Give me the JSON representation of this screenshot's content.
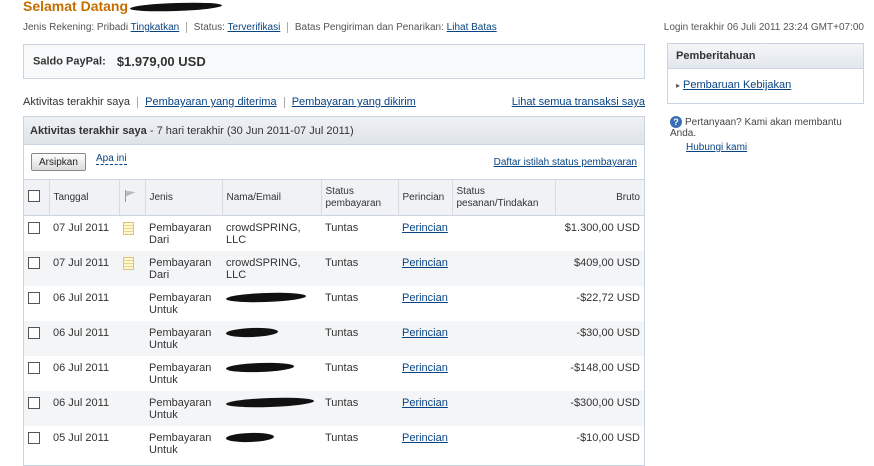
{
  "header": {
    "welcome": "Selamat Datang",
    "account_type_label": "Jenis Rekening: Pribadi",
    "upgrade_link": "Tingkatkan",
    "status_label": "Status:",
    "status_link": "Terverifikasi",
    "limits_label": "Batas Pengiriman dan Penarikan:",
    "limits_link": "Lihat Batas",
    "last_login": "Login terakhir 06 Juli 2011 23:24 GMT+07:00"
  },
  "balance": {
    "label": "Saldo PayPal:",
    "amount": "$1.979,00 USD"
  },
  "activity_links": {
    "recent": "Aktivitas terakhir saya",
    "received": "Pembayaran yang diterima",
    "sent": "Pembayaran yang dikirim",
    "see_all": "Lihat semua transaksi saya"
  },
  "activity": {
    "title": "Aktivitas terakhir saya",
    "subtitle": " - 7 hari terakhir (30 Jun 2011-07 Jul 2011)",
    "archive_button": "Arsipkan",
    "what_link": "Apa ini",
    "glossary_link": "Daftar istilah status pembayaran",
    "columns": {
      "date": "Tanggal",
      "type": "Jenis",
      "name": "Nama/Email",
      "payment_status": "Status pembayaran",
      "details": "Perincian",
      "order_status": "Status pesanan/Tindakan",
      "gross": "Bruto"
    },
    "rows": [
      {
        "date": "07 Jul 2011",
        "note": true,
        "type": "Pembayaran Dari",
        "name": "crowdSPRING, LLC",
        "name_redacted": false,
        "status": "Tuntas",
        "details": "Perincian",
        "order": "",
        "gross": "$1.300,00 USD"
      },
      {
        "date": "07 Jul 2011",
        "note": true,
        "type": "Pembayaran Dari",
        "name": "crowdSPRING, LLC",
        "name_redacted": false,
        "status": "Tuntas",
        "details": "Perincian",
        "order": "",
        "gross": "$409,00 USD"
      },
      {
        "date": "06 Jul 2011",
        "note": false,
        "type": "Pembayaran Untuk",
        "name": "",
        "name_redacted": true,
        "status": "Tuntas",
        "details": "Perincian",
        "order": "",
        "gross": "-$22,72 USD"
      },
      {
        "date": "06 Jul 2011",
        "note": false,
        "type": "Pembayaran Untuk",
        "name": "",
        "name_redacted": true,
        "status": "Tuntas",
        "details": "Perincian",
        "order": "",
        "gross": "-$30,00 USD"
      },
      {
        "date": "06 Jul 2011",
        "note": false,
        "type": "Pembayaran Untuk",
        "name": "",
        "name_redacted": true,
        "status": "Tuntas",
        "details": "Perincian",
        "order": "",
        "gross": "-$148,00 USD"
      },
      {
        "date": "06 Jul 2011",
        "note": false,
        "type": "Pembayaran Untuk",
        "name": "",
        "name_redacted": true,
        "status": "Tuntas",
        "details": "Perincian",
        "order": "",
        "gross": "-$300,00 USD"
      },
      {
        "date": "05 Jul 2011",
        "note": false,
        "type": "Pembayaran Untuk",
        "name": "",
        "name_redacted": true,
        "status": "Tuntas",
        "details": "Perincian",
        "order": "",
        "gross": "-$10,00 USD"
      }
    ]
  },
  "notifications": {
    "title": "Pemberitahuan",
    "item": "Pembaruan Kebijakan"
  },
  "help": {
    "question": "Pertanyaan? Kami akan membantu Anda.",
    "contact": "Hubungi kami",
    "icon": "question-icon"
  },
  "colors": {
    "welcome": "#c46e00",
    "link": "#084482",
    "panel_border": "#c9d4e0"
  }
}
